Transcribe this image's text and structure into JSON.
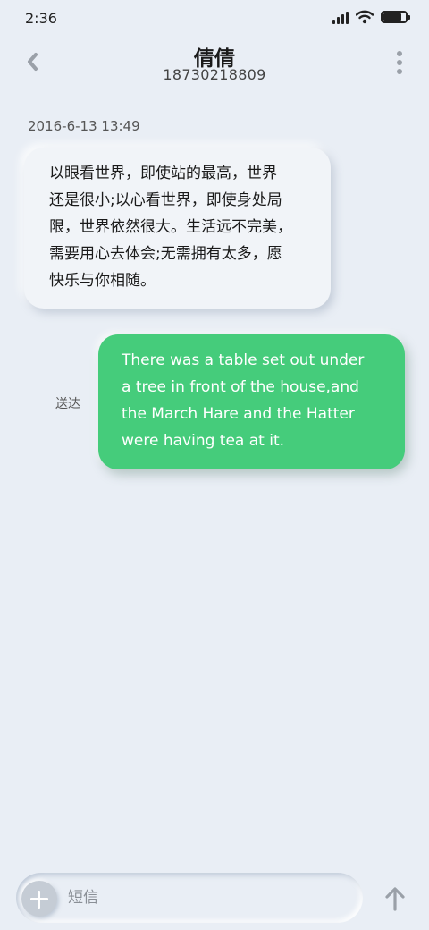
{
  "status_bar": {
    "time": "2:36",
    "battery_level": 0.85,
    "signal_icon": "cellular-signal-icon",
    "wifi_icon": "wifi-icon",
    "battery_icon": "battery-icon"
  },
  "header": {
    "contact_name": "倩倩",
    "contact_number": "18730218809",
    "back_icon": "chevron-left-icon",
    "more_icon": "more-vertical-icon"
  },
  "conversation": {
    "timestamp": "2016-6-13 13:49",
    "messages": [
      {
        "direction": "incoming",
        "lines": [
          "以眼看世界，即使站的最高，世界",
          "还是很小;以心看世界，即使身处局",
          "限，世界依然很大。生活远不完美，",
          "需要用心去体会;无需拥有太多，愿",
          "快乐与你相随。"
        ]
      },
      {
        "direction": "outgoing",
        "status": "送达",
        "lines": [
          "There was a table set out under",
          "a tree in front of the house,and",
          "the March Hare and the Hatter",
          "were having tea at it."
        ]
      }
    ]
  },
  "composer": {
    "placeholder": "短信",
    "add_icon": "plus-icon",
    "send_icon": "arrow-up-icon"
  },
  "colors": {
    "background": "#e9eef5",
    "incoming_bubble": "#f1f4f8",
    "outgoing_bubble": "#45cc7b"
  }
}
